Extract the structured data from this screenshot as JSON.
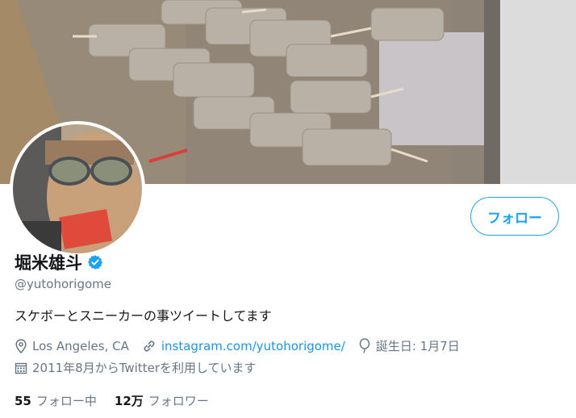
{
  "profile": {
    "name": "堀米雄斗",
    "handle": "@yutohorigome",
    "bio": "スケボーとスニーカーの事ツイートしてます",
    "location": "Los Angeles, CA",
    "website": "instagram.com/yutohorigome/",
    "birthday": "誕生日: 1月7日",
    "joined": "2011年8月からTwitterを利用しています"
  },
  "actions": {
    "follow_label": "フォロー"
  },
  "stats": {
    "following_count": "55",
    "following_label": "フォロー中",
    "followers_count": "12万",
    "followers_label": "フォロワー"
  },
  "icons": {
    "verified": "verified-badge-icon",
    "location": "location-pin-icon",
    "link": "link-icon",
    "birthday": "balloon-icon",
    "joined": "calendar-icon"
  },
  "colors": {
    "accent": "#1da1f2",
    "link": "#1b95e0",
    "secondary_text": "#657786",
    "primary_text": "#14171a"
  }
}
